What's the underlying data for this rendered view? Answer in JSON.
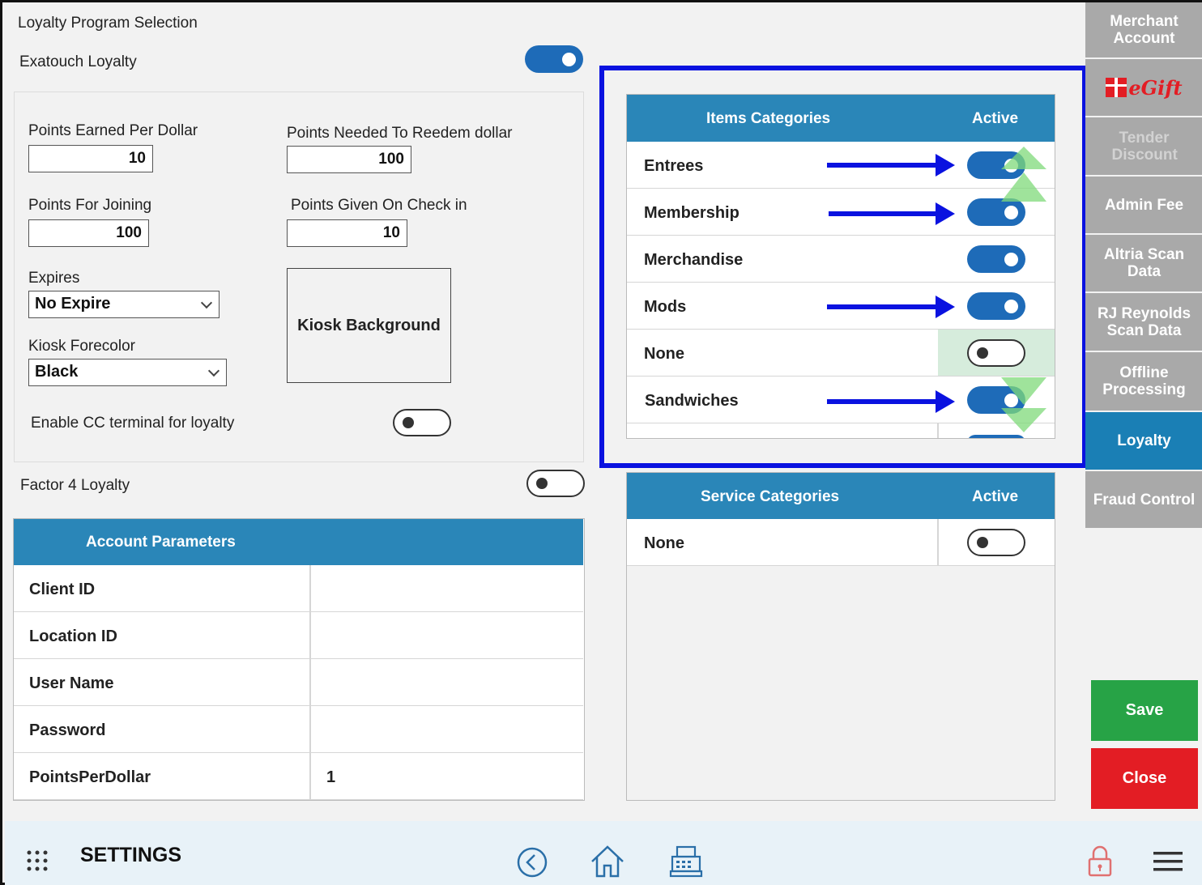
{
  "colors": {
    "header_blue": "#2a86b8",
    "toggle_on": "#1e6bb8",
    "highlight_box": "#0a12e0",
    "save_green": "#27a346",
    "close_red": "#e31d24",
    "active_tab": "#1a7fb5"
  },
  "loyalty": {
    "section_title": "Loyalty Program Selection",
    "exatouch_label": "Exatouch Loyalty",
    "exatouch_on": true,
    "points_earned_label": "Points Earned Per Dollar",
    "points_earned_value": "10",
    "points_redeem_label": "Points Needed To Reedem dollar",
    "points_redeem_value": "100",
    "points_joining_label": "Points For Joining",
    "points_joining_value": "100",
    "points_checkin_label": "Points Given On Check in",
    "points_checkin_value": "10",
    "expires_label": "Expires",
    "expires_value": "No Expire",
    "forecolor_label": "Kiosk Forecolor",
    "forecolor_value": "Black",
    "kiosk_background_label": "Kiosk Background",
    "cc_terminal_label": "Enable CC terminal for loyalty",
    "cc_terminal_on": false,
    "factor4_label": "Factor 4 Loyalty",
    "factor4_on": false
  },
  "account_params": {
    "header": "Account Parameters",
    "rows": [
      {
        "label": "Client ID",
        "value": ""
      },
      {
        "label": "Location ID",
        "value": ""
      },
      {
        "label": "User Name",
        "value": ""
      },
      {
        "label": "Password",
        "value": ""
      },
      {
        "label": "PointsPerDollar",
        "value": "1"
      }
    ]
  },
  "items_categories": {
    "header_name": "Items Categories",
    "header_active": "Active",
    "rows": [
      {
        "name": "Entrees",
        "active": true
      },
      {
        "name": "Membership",
        "active": true
      },
      {
        "name": "Merchandise",
        "active": true
      },
      {
        "name": "Mods",
        "active": true
      },
      {
        "name": "None",
        "active": false
      },
      {
        "name": "Sandwiches",
        "active": true
      }
    ]
  },
  "service_categories": {
    "header_name": "Service Categories",
    "header_active": "Active",
    "rows": [
      {
        "name": "None",
        "active": false
      }
    ]
  },
  "sidebar": {
    "items": [
      {
        "label": "Merchant Account"
      },
      {
        "label": "eGift"
      },
      {
        "label": "Tender Discount"
      },
      {
        "label": "Admin Fee"
      },
      {
        "label": "Altria Scan Data"
      },
      {
        "label": "RJ Reynolds Scan Data"
      },
      {
        "label": "Offline Processing"
      },
      {
        "label": "Loyalty"
      },
      {
        "label": "Fraud Control"
      }
    ],
    "save_label": "Save",
    "close_label": "Close"
  },
  "bottom_bar": {
    "title": "SETTINGS",
    "icons": [
      "grid-icon",
      "back-icon",
      "home-icon",
      "register-icon",
      "lock-icon",
      "menu-icon"
    ]
  }
}
